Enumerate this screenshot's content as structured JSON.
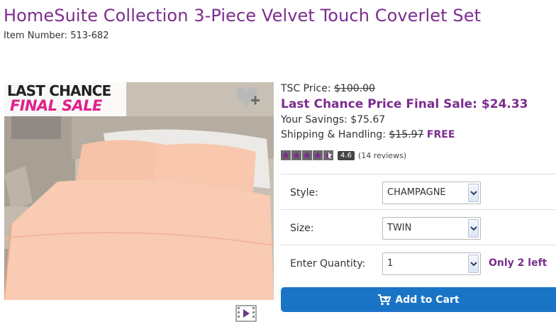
{
  "product": {
    "title": "HomeSuite Collection 3-Piece Velvet Touch Coverlet Set",
    "item_number": "Item Number: 513-682"
  },
  "badge": {
    "line1": "LAST CHANCE",
    "line2": "FINAL SALE"
  },
  "icons": {
    "wishlist": "heart-plus-icon",
    "video": "video-play-icon",
    "cart": "shopping-cart-icon"
  },
  "pricing": {
    "tsc_label": "TSC Price:",
    "tsc_value": "$100.00",
    "final_label": "Last Chance Price Final Sale:",
    "final_value": "$24.33",
    "savings_label": "Your Savings:",
    "savings_value": "$75.67",
    "shipping_label": "Shipping & Handling:",
    "shipping_old": "$15.97",
    "shipping_new": "FREE"
  },
  "rating": {
    "stars": 4.6,
    "badge": "4.6",
    "reviews": "(14 reviews)"
  },
  "options": {
    "style_label": "Style:",
    "style_value": "CHAMPAGNE",
    "size_label": "Size:",
    "size_value": "TWIN",
    "qty_label": "Enter Quantity:",
    "qty_value": "1",
    "stock_note": "Only 2 left"
  },
  "cart": {
    "button_label": "Add to Cart"
  },
  "colors": {
    "accent": "#7b2d8e",
    "button": "#1a74c6",
    "sale_pink": "#e0218a"
  }
}
